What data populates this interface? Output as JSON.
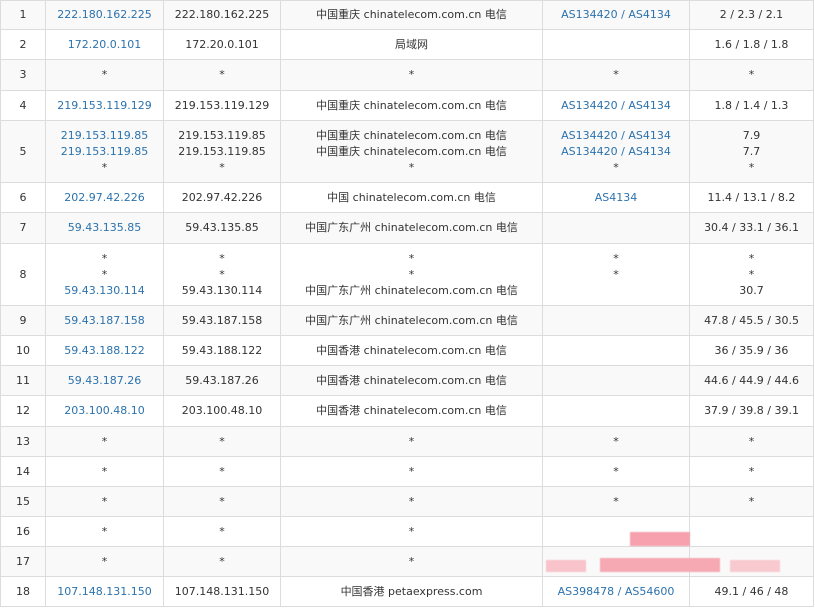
{
  "rows": [
    {
      "hop": "1",
      "ip": [
        "222.180.162.225"
      ],
      "host": [
        "222.180.162.225"
      ],
      "loc": [
        "中国重庆 chinatelecom.com.cn 电信"
      ],
      "asn": [
        "AS134420 / AS4134"
      ],
      "lat": [
        "2 / 2.3 / 2.1"
      ]
    },
    {
      "hop": "2",
      "ip": [
        "172.20.0.101"
      ],
      "host": [
        "172.20.0.101"
      ],
      "loc": [
        "局域网"
      ],
      "asn": [
        ""
      ],
      "lat": [
        "1.6 / 1.8 / 1.8"
      ]
    },
    {
      "hop": "3",
      "ip": [
        "*"
      ],
      "host": [
        "*"
      ],
      "loc": [
        "*"
      ],
      "asn": [
        "*"
      ],
      "lat": [
        "*"
      ]
    },
    {
      "hop": "4",
      "ip": [
        "219.153.119.129"
      ],
      "host": [
        "219.153.119.129"
      ],
      "loc": [
        "中国重庆 chinatelecom.com.cn 电信"
      ],
      "asn": [
        "AS134420 / AS4134"
      ],
      "lat": [
        "1.8 / 1.4 / 1.3"
      ]
    },
    {
      "hop": "5",
      "ip": [
        "219.153.119.85",
        "219.153.119.85",
        "*"
      ],
      "host": [
        "219.153.119.85",
        "219.153.119.85",
        "*"
      ],
      "loc": [
        "中国重庆 chinatelecom.com.cn 电信",
        "中国重庆 chinatelecom.com.cn 电信",
        "*"
      ],
      "asn": [
        "AS134420 / AS4134",
        "AS134420 / AS4134",
        "*"
      ],
      "lat": [
        "7.9",
        "7.7",
        "*"
      ]
    },
    {
      "hop": "6",
      "ip": [
        "202.97.42.226"
      ],
      "host": [
        "202.97.42.226"
      ],
      "loc": [
        "中国 chinatelecom.com.cn 电信"
      ],
      "asn": [
        "AS4134"
      ],
      "lat": [
        "11.4 / 13.1 / 8.2"
      ]
    },
    {
      "hop": "7",
      "ip": [
        "59.43.135.85"
      ],
      "host": [
        "59.43.135.85"
      ],
      "loc": [
        "中国广东广州 chinatelecom.com.cn 电信"
      ],
      "asn": [
        ""
      ],
      "lat": [
        "30.4 / 33.1 / 36.1"
      ]
    },
    {
      "hop": "8",
      "ip": [
        "*",
        "*",
        "59.43.130.114"
      ],
      "host": [
        "*",
        "*",
        "59.43.130.114"
      ],
      "loc": [
        "*",
        "*",
        "中国广东广州 chinatelecom.com.cn 电信"
      ],
      "asn": [
        "*",
        "*",
        ""
      ],
      "lat": [
        "*",
        "*",
        "30.7"
      ]
    },
    {
      "hop": "9",
      "ip": [
        "59.43.187.158"
      ],
      "host": [
        "59.43.187.158"
      ],
      "loc": [
        "中国广东广州 chinatelecom.com.cn 电信"
      ],
      "asn": [
        ""
      ],
      "lat": [
        "47.8 / 45.5 / 30.5"
      ]
    },
    {
      "hop": "10",
      "ip": [
        "59.43.188.122"
      ],
      "host": [
        "59.43.188.122"
      ],
      "loc": [
        "中国香港 chinatelecom.com.cn 电信"
      ],
      "asn": [
        ""
      ],
      "lat": [
        "36 / 35.9 / 36"
      ]
    },
    {
      "hop": "11",
      "ip": [
        "59.43.187.26"
      ],
      "host": [
        "59.43.187.26"
      ],
      "loc": [
        "中国香港 chinatelecom.com.cn 电信"
      ],
      "asn": [
        ""
      ],
      "lat": [
        "44.6 / 44.9 / 44.6"
      ]
    },
    {
      "hop": "12",
      "ip": [
        "203.100.48.10"
      ],
      "host": [
        "203.100.48.10"
      ],
      "loc": [
        "中国香港 chinatelecom.com.cn 电信"
      ],
      "asn": [
        ""
      ],
      "lat": [
        "37.9 / 39.8 / 39.1"
      ]
    },
    {
      "hop": "13",
      "ip": [
        "*"
      ],
      "host": [
        "*"
      ],
      "loc": [
        "*"
      ],
      "asn": [
        "*"
      ],
      "lat": [
        "*"
      ]
    },
    {
      "hop": "14",
      "ip": [
        "*"
      ],
      "host": [
        "*"
      ],
      "loc": [
        "*"
      ],
      "asn": [
        "*"
      ],
      "lat": [
        "*"
      ]
    },
    {
      "hop": "15",
      "ip": [
        "*"
      ],
      "host": [
        "*"
      ],
      "loc": [
        "*"
      ],
      "asn": [
        "*"
      ],
      "lat": [
        "*"
      ]
    },
    {
      "hop": "16",
      "ip": [
        "*"
      ],
      "host": [
        "*"
      ],
      "loc": [
        "*"
      ],
      "asn": [
        ""
      ],
      "lat": [
        ""
      ]
    },
    {
      "hop": "17",
      "ip": [
        "*"
      ],
      "host": [
        "*"
      ],
      "loc": [
        "*"
      ],
      "asn": [
        ""
      ],
      "lat": [
        ""
      ]
    },
    {
      "hop": "18",
      "ip": [
        "107.148.131.150"
      ],
      "host": [
        "107.148.131.150"
      ],
      "loc": [
        "中国香港 petaexpress.com"
      ],
      "asn": [
        "AS398478 / AS54600"
      ],
      "lat": [
        "49.1 / 46 / 48"
      ]
    }
  ]
}
